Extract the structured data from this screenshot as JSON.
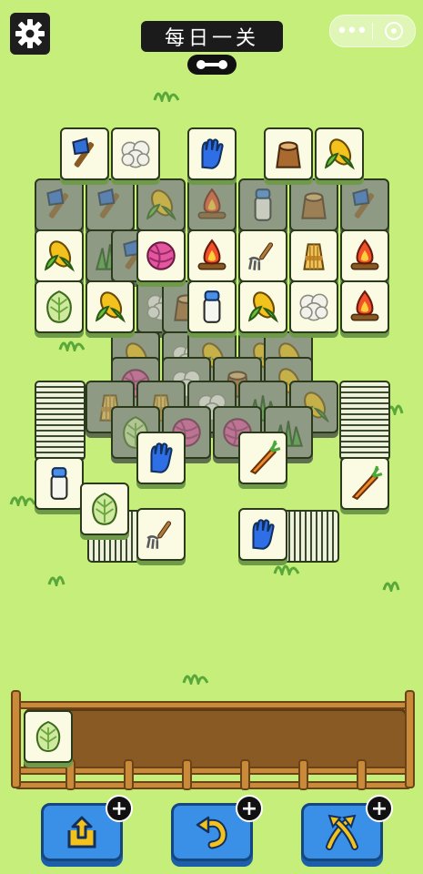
{
  "header": {
    "title": "每日一关",
    "settings_icon": "gear-icon",
    "menu_icon": "more-dots-icon",
    "close_icon": "target-circle-icon"
  },
  "tile_icons": [
    "hand-axe",
    "cotton",
    "blue-glove",
    "tree-stump",
    "corn",
    "yarn-ball",
    "campfire",
    "pitchfork",
    "wheat-bundle",
    "cabbage",
    "milk-bottle",
    "carrot",
    "grass"
  ],
  "tray": {
    "slots_filled": 1,
    "slot_icon": "cabbage"
  },
  "powerups": [
    {
      "name": "move-out",
      "icon": "move-out-icon",
      "badge": "+"
    },
    {
      "name": "undo",
      "icon": "undo-icon",
      "badge": "+"
    },
    {
      "name": "shuffle",
      "icon": "shuffle-icon",
      "badge": "+"
    }
  ],
  "colors": {
    "background": "#c5ef7a",
    "tile_face": "#fbfbe4",
    "tile_dim": "#8f9a84",
    "button": "#3a8fe6",
    "tray_wood": "#8a5a24"
  }
}
